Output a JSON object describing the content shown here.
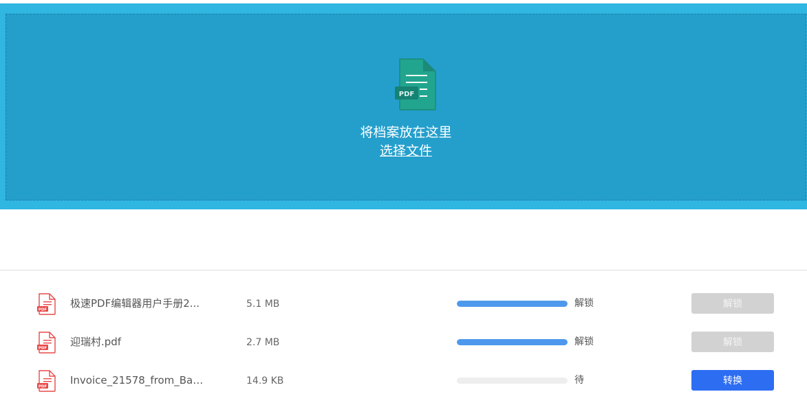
{
  "drop_zone": {
    "icon": "pdf-file-icon",
    "icon_badge": "PDF",
    "title": "将档案放在这里",
    "choose_file_label": "选择文件"
  },
  "files": [
    {
      "icon": "pdf-file-icon",
      "name": "极速PDF编辑器用户手册2...",
      "size": "5.1 MB",
      "progress": 1.0,
      "status": "解锁",
      "action_label": "解锁",
      "action_state": "disabled"
    },
    {
      "icon": "pdf-file-icon",
      "name": "迎瑞村.pdf",
      "size": "2.7 MB",
      "progress": 1.0,
      "status": "解锁",
      "action_label": "解锁",
      "action_state": "disabled"
    },
    {
      "icon": "pdf-file-icon",
      "name": "Invoice_21578_from_Bay_...",
      "size": "14.9 KB",
      "progress": 0.0,
      "status": "待",
      "action_label": "转换",
      "action_state": "primary"
    }
  ],
  "colors": {
    "drop_outer": "#2fb6e1",
    "drop_inner": "#249fcc",
    "icon_green": "#22a58f",
    "progress_fill": "#4d98ec",
    "primary_button": "#2d6df2",
    "disabled_button": "#d2d2d2",
    "pdf_red": "#e84848"
  }
}
